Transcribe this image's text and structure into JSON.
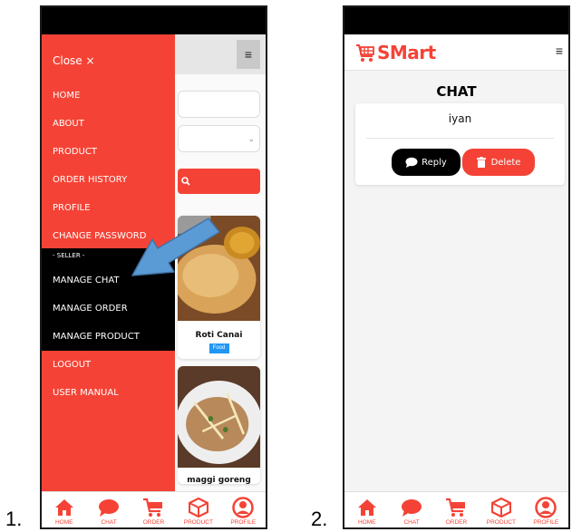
{
  "figure_labels": [
    "1.",
    "2."
  ],
  "colors": {
    "primary": "#f44336",
    "dark": "#000000",
    "tag": "#2196f3"
  },
  "phone1": {
    "drawer": {
      "close_label": "Close ×",
      "items": [
        {
          "label": "HOME"
        },
        {
          "label": "ABOUT"
        },
        {
          "label": "PRODUCT"
        },
        {
          "label": "ORDER HISTORY"
        },
        {
          "label": "PROFILE"
        },
        {
          "label": "CHANGE PASSWORD"
        }
      ],
      "seller_label": "- SELLER -",
      "seller_items": [
        {
          "label": "MANAGE CHAT"
        },
        {
          "label": "MANAGE ORDER"
        },
        {
          "label": "MANAGE PRODUCT"
        }
      ],
      "bottom_items": [
        {
          "label": "LOGOUT"
        },
        {
          "label": "USER MANUAL"
        }
      ]
    },
    "menu_icon": "hamburger-icon",
    "products": [
      {
        "name": "Roti Canai",
        "tag": "Food"
      },
      {
        "name": "maggi goreng"
      }
    ]
  },
  "phone2": {
    "brand": "SMart",
    "page_title": "CHAT",
    "chat": {
      "user": "iyan",
      "reply_label": "Reply",
      "delete_label": "Delete"
    }
  },
  "bottom_nav": [
    {
      "label": "HOME",
      "icon": "home-icon"
    },
    {
      "label": "CHAT",
      "icon": "chat-icon"
    },
    {
      "label": "ORDER",
      "icon": "cart-icon"
    },
    {
      "label": "PRODUCT",
      "icon": "box-icon"
    },
    {
      "label": "PROFILE",
      "icon": "user-icon"
    }
  ]
}
